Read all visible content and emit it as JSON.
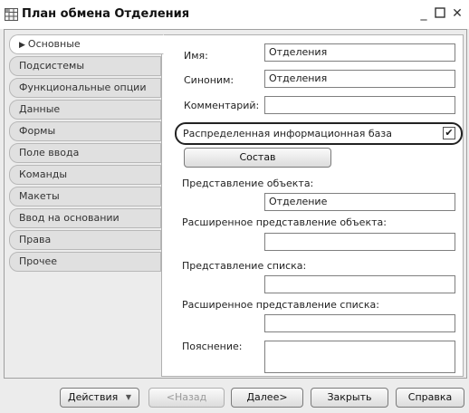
{
  "window": {
    "title": "План обмена Отделения"
  },
  "tabs": [
    {
      "label": "Основные"
    },
    {
      "label": "Подсистемы"
    },
    {
      "label": "Функциональные опции"
    },
    {
      "label": "Данные"
    },
    {
      "label": "Формы"
    },
    {
      "label": "Поле ввода"
    },
    {
      "label": "Команды"
    },
    {
      "label": "Макеты"
    },
    {
      "label": "Ввод на основании"
    },
    {
      "label": "Права"
    },
    {
      "label": "Прочее"
    }
  ],
  "form": {
    "name_label": "Имя:",
    "name_value": "Отделения",
    "synonym_label": "Синоним:",
    "synonym_value": "Отделения",
    "comment_label": "Комментарий:",
    "comment_value": "",
    "distributed_label": "Распределенная информационная база",
    "distributed_checked": "✔",
    "composition_button": "Состав",
    "object_repr_label": "Представление объекта:",
    "object_repr_value": "Отделение",
    "ext_object_repr_label": "Расширенное представление объекта:",
    "ext_object_repr_value": "",
    "list_repr_label": "Представление списка:",
    "list_repr_value": "",
    "ext_list_repr_label": "Расширенное представление списка:",
    "ext_list_repr_value": "",
    "explanation_label": "Пояснение:",
    "explanation_value": ""
  },
  "footer": {
    "actions": "Действия",
    "back": "<Назад",
    "next": "Далее>",
    "close": "Закрыть",
    "help": "Справка"
  }
}
